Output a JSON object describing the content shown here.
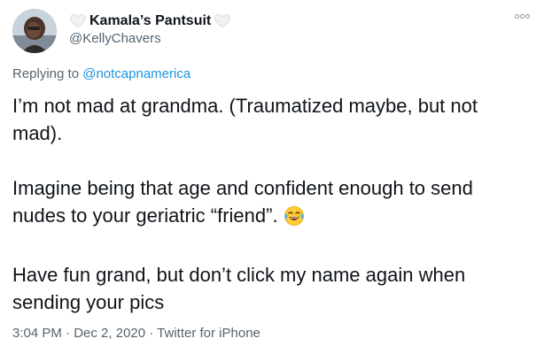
{
  "user": {
    "display_name": "Kamala’s Pantsuit",
    "handle": "@KellyChavers"
  },
  "reply": {
    "prefix": "Replying to ",
    "mention": "@notcapnamerica"
  },
  "tweet": {
    "paragraphs": [
      "I’m not mad at grandma. (Traumatized maybe, but not mad).",
      "Imagine being that age and confident enough to send nudes to your geriatric “friend”.",
      "Have fun grand, but don’t click my name again when sending your pics"
    ],
    "emoji": "face-with-tears-of-joy"
  },
  "meta": {
    "time": "3:04 PM",
    "date": "Dec 2, 2020",
    "source": "Twitter for iPhone",
    "separator": " · "
  },
  "icons": {
    "heart_left": "white-heart-icon",
    "heart_right": "white-heart-icon",
    "more": "more-options-icon"
  },
  "colors": {
    "text": "#0f1419",
    "secondary": "#536471",
    "link": "#1b95e0"
  }
}
